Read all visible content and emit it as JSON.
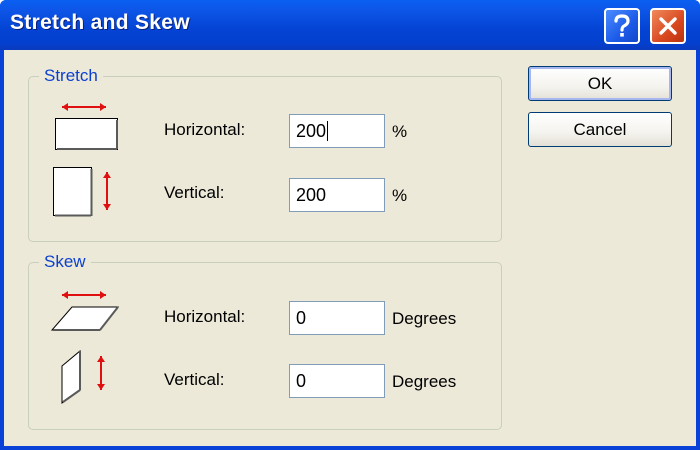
{
  "window": {
    "title": "Stretch and Skew",
    "help_icon": "question-mark-icon",
    "close_icon": "close-x-icon"
  },
  "stretch": {
    "group_label": "Stretch",
    "horizontal_label": "Horizontal:",
    "horizontal_value": "200",
    "horizontal_unit": "%",
    "vertical_label": "Vertical:",
    "vertical_value": "200",
    "vertical_unit": "%",
    "horizontal_icon": "stretch-horizontal-icon",
    "vertical_icon": "stretch-vertical-icon"
  },
  "skew": {
    "group_label": "Skew",
    "horizontal_label": "Horizontal:",
    "horizontal_value": "0",
    "horizontal_unit": "Degrees",
    "vertical_label": "Vertical:",
    "vertical_value": "0",
    "vertical_unit": "Degrees",
    "horizontal_icon": "skew-horizontal-icon",
    "vertical_icon": "skew-vertical-icon"
  },
  "buttons": {
    "ok_label": "OK",
    "cancel_label": "Cancel"
  },
  "colors": {
    "title_bar": "#0842d6",
    "dialog_face": "#ece9d8",
    "group_label": "#0b3fd0",
    "arrow_red": "#e01010"
  }
}
